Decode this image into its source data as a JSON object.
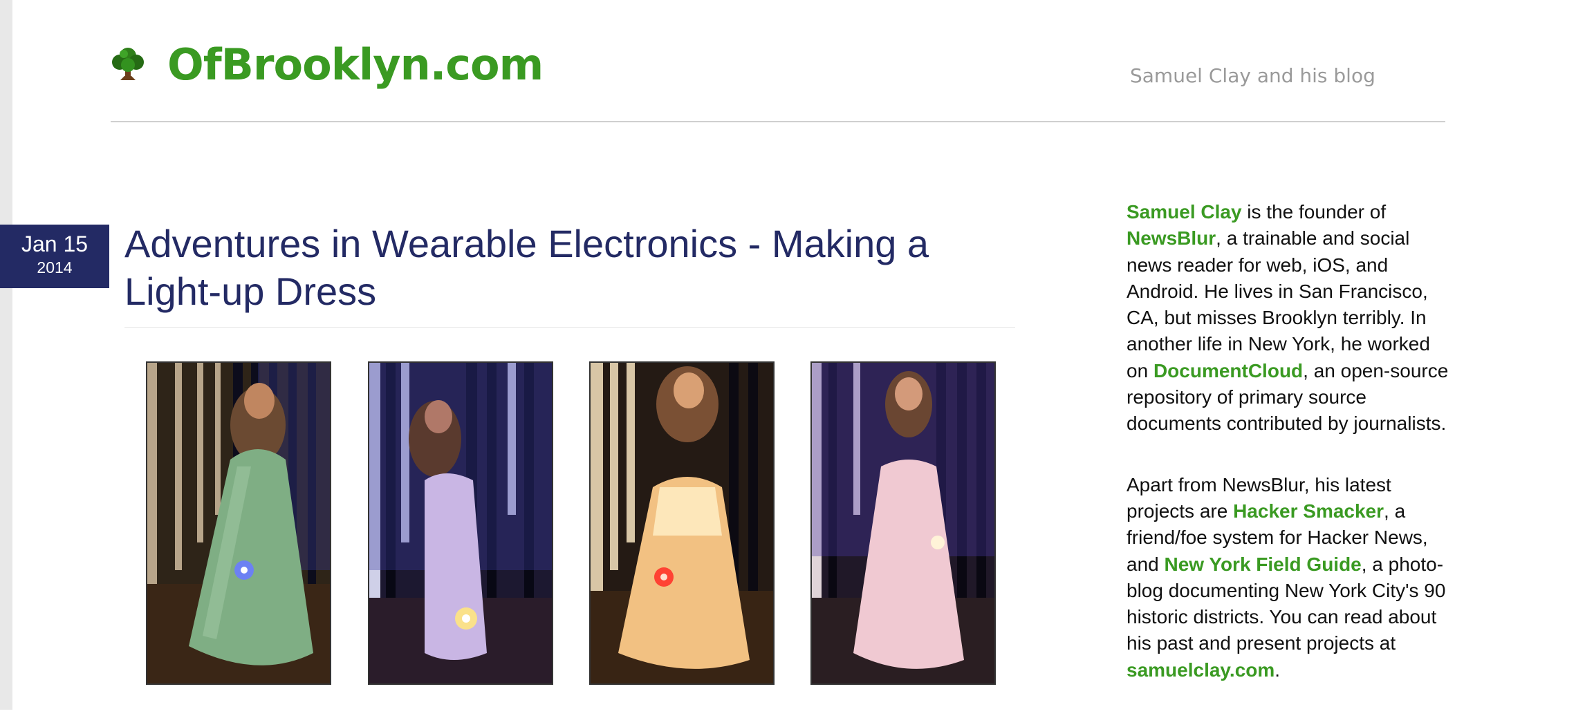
{
  "header": {
    "site_title": "OfBrooklyn.com",
    "tagline": "Samuel Clay and his blog",
    "logo_icon": "tree-icon"
  },
  "post": {
    "date": {
      "day": "Jan 15",
      "year": "2014"
    },
    "title": "Adventures in Wearable Electronics - Making a Light-up Dress",
    "photos": [
      {
        "name": "dress-photo-1",
        "dress_color": "green",
        "light_color": "blue"
      },
      {
        "name": "dress-photo-2",
        "dress_color": "lavender",
        "light_color": "yellow"
      },
      {
        "name": "dress-photo-3",
        "dress_color": "amber",
        "light_color": "red"
      },
      {
        "name": "dress-photo-4",
        "dress_color": "pink",
        "light_color": "white"
      }
    ]
  },
  "sidebar": {
    "bio": {
      "name_link": "Samuel Clay",
      "text_1": " is the founder of ",
      "newsblur_link": "NewsBlur",
      "text_2": ", a trainable and social news reader for web, iOS, and Android. He lives in San Francisco, CA, but misses Brooklyn terribly. In another life in New York, he worked on ",
      "documentcloud_link": "DocumentCloud",
      "text_3": ", an open-source repository of primary source documents contributed by journalists."
    },
    "projects": {
      "text_1": "Apart from NewsBlur, his latest projects are ",
      "hacker_smacker_link": "Hacker Smacker",
      "text_2": ", a friend/foe system for Hacker News, and ",
      "nyfg_link": "New York Field Guide",
      "text_3": ", a photo-blog documenting New York City's 90 historic districts. You can read about his past and present projects at ",
      "samuelclay_link": "samuelclay.com",
      "text_4": "."
    }
  },
  "colors": {
    "brand_green": "#3a9a22",
    "navy": "#232a64",
    "tagline_gray": "#9a9a9a"
  }
}
